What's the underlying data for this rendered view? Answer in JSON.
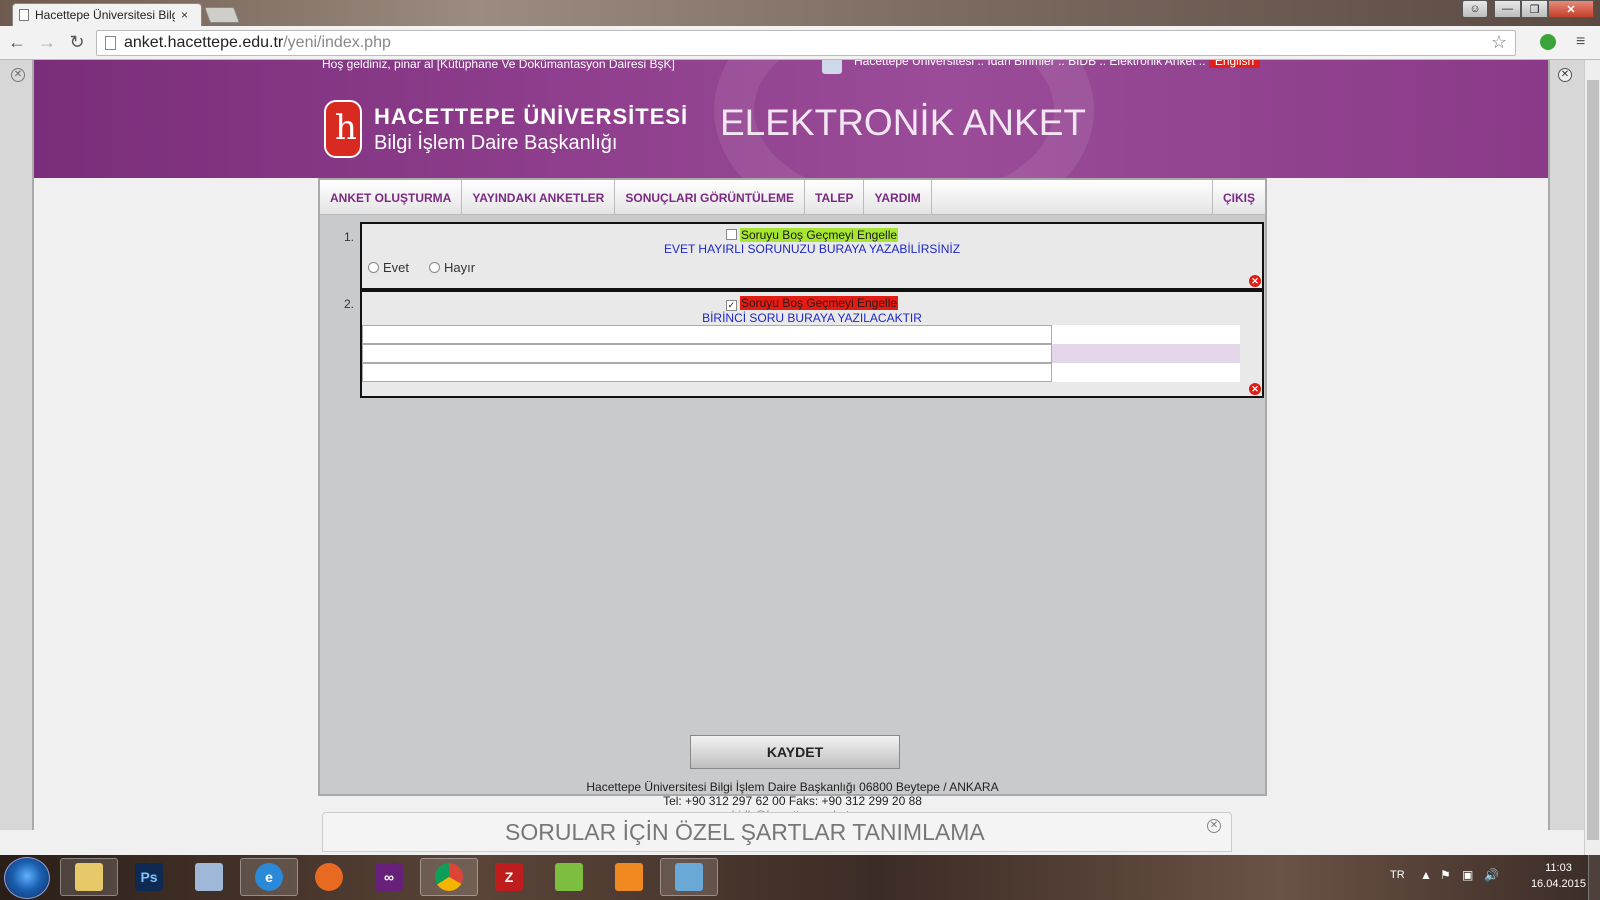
{
  "browser": {
    "tab_title": "Hacettepe Üniversitesi Bilgi",
    "tab_close": "×",
    "url_host": "anket.hacettepe.edu.tr",
    "url_path": "/yeni/index.php"
  },
  "header": {
    "welcome": "Hoş geldiniz, pinar al [Kütüphane Ve Dokümantasyon Dairesi BşK]",
    "breadcrumbs": "Hacettepe Üniversitesi .. İdari Birimler .. BİDB .. Elektronik Anket ..",
    "english_link": "English",
    "university": "HACETTEPE ÜNİVERSİTESİ",
    "department": "Bilgi İşlem Daire Başkanlığı",
    "app_title": "ELEKTRONİK ANKET"
  },
  "nav": {
    "items": [
      "ANKET OLUŞTURMA",
      "YAYINDAKI ANKETLER",
      "SONUÇLARI GÖRÜNTÜLEME",
      "TALEP",
      "YARDIM"
    ],
    "logout": "ÇIKIŞ"
  },
  "questions": [
    {
      "number": "1.",
      "required_label": "Soruyu Boş Geçmeyi Engelle",
      "required_checked": false,
      "text": "EVET HAYIRLI SORUNUZU BURAYA YAZABİLİRSİNİZ",
      "options": [
        "Evet",
        "Hayır"
      ]
    },
    {
      "number": "2.",
      "required_label": "Soruyu Boş Geçmeyi Engelle",
      "required_checked": true,
      "text": "BİRİNCİ SORU BURAYA YAZILACAKTIR",
      "rows": [
        "",
        "",
        ""
      ]
    }
  ],
  "save_label": "KAYDET",
  "footer": {
    "address": "Hacettepe Üniversitesi Bilgi İşlem Daire Başkanlığı 06800 Beytepe / ANKARA",
    "phone": "Tel: +90 312 297 62 00 Faks: +90 312 299 20 88",
    "email": "bidb@hacettepe.edu.tr"
  },
  "popup_title": "SORULAR İÇİN ÖZEL ŞARTLAR TANIMLAMA",
  "taskbar": {
    "ps_label": "Ps",
    "fz_label": "Z",
    "lang": "TR",
    "time": "11:03",
    "date": "16.04.2015"
  }
}
